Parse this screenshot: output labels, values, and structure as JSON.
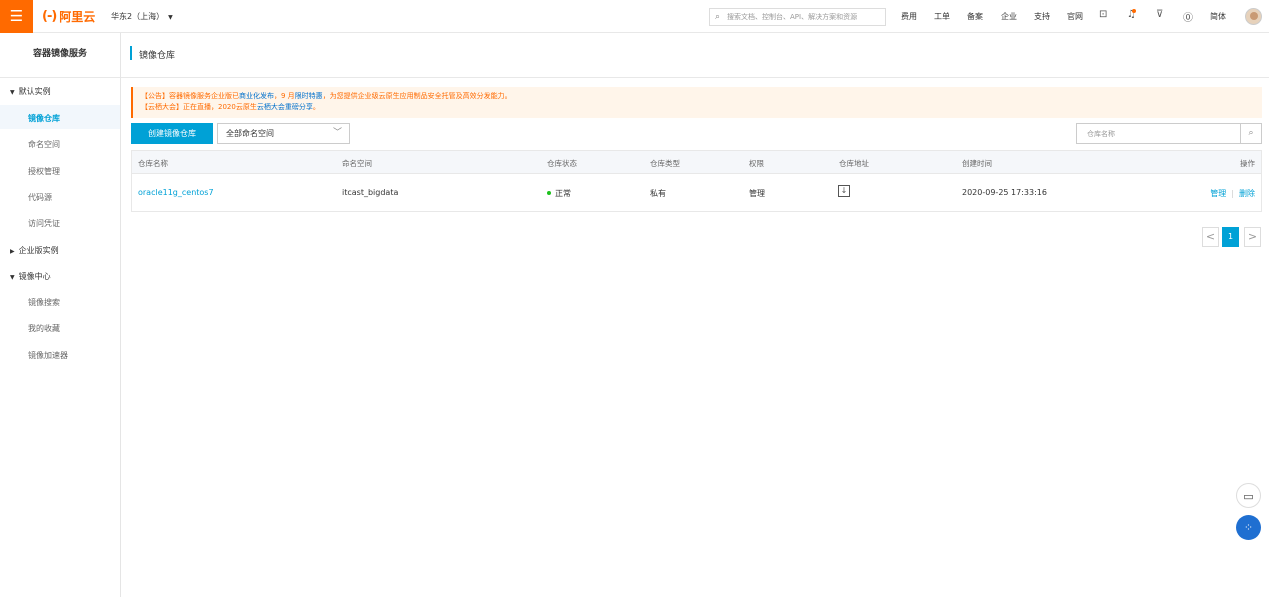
{
  "topbar": {
    "menu_icon": "hamburger-icon",
    "logo_mark": "(-)",
    "logo_text": "阿里云",
    "region": "华东2（上海）",
    "search_placeholder": "搜索文档、控制台、API、解决方案和资源",
    "nav": [
      "费用",
      "工单",
      "备案",
      "企业",
      "支持",
      "官网"
    ],
    "lang": "简体",
    "accent": "#ff6a00"
  },
  "sidebar": {
    "title": "容器镜像服务",
    "groups": [
      {
        "label": "默认实例",
        "items": [
          "镜像仓库",
          "命名空间",
          "授权管理",
          "代码源",
          "访问凭证"
        ]
      },
      {
        "label": "企业版实例",
        "items": []
      },
      {
        "label": "镜像中心",
        "items": [
          "镜像搜索",
          "我的收藏",
          "镜像加速器"
        ]
      }
    ],
    "active_item": "镜像仓库"
  },
  "main": {
    "title": "镜像仓库",
    "notice": {
      "line1_prefix": "【公告】容器镜像服务企业版已",
      "line1_link1": "商业化发布",
      "line1_mid": "，9 月",
      "line1_link2": "限时特惠",
      "line1_suffix": "，为您提供企业级云原生应用制品安全托管及高效分发能力。",
      "line2_prefix": "【云栖大会】正在直播，2020云原生",
      "line2_link": "云栖大会重磅分享",
      "line2_suffix": "。"
    },
    "create_button": "创建镜像仓库",
    "namespace_select": "全部命名空间",
    "repo_search_placeholder": "仓库名称",
    "table": {
      "headers": [
        "仓库名称",
        "命名空间",
        "仓库状态",
        "仓库类型",
        "权限",
        "仓库地址",
        "创建时间",
        "操作"
      ],
      "rows": [
        {
          "name": "oracle11g_centos7",
          "namespace": "itcast_bigdata",
          "status": "正常",
          "type": "私有",
          "permission": "管理",
          "address_icon": "download-icon",
          "created": "2020-09-25 17:33:16",
          "actions": [
            "管理",
            "删除"
          ]
        }
      ]
    },
    "pagination": {
      "prev": "<",
      "current": "1",
      "next": ">"
    }
  }
}
